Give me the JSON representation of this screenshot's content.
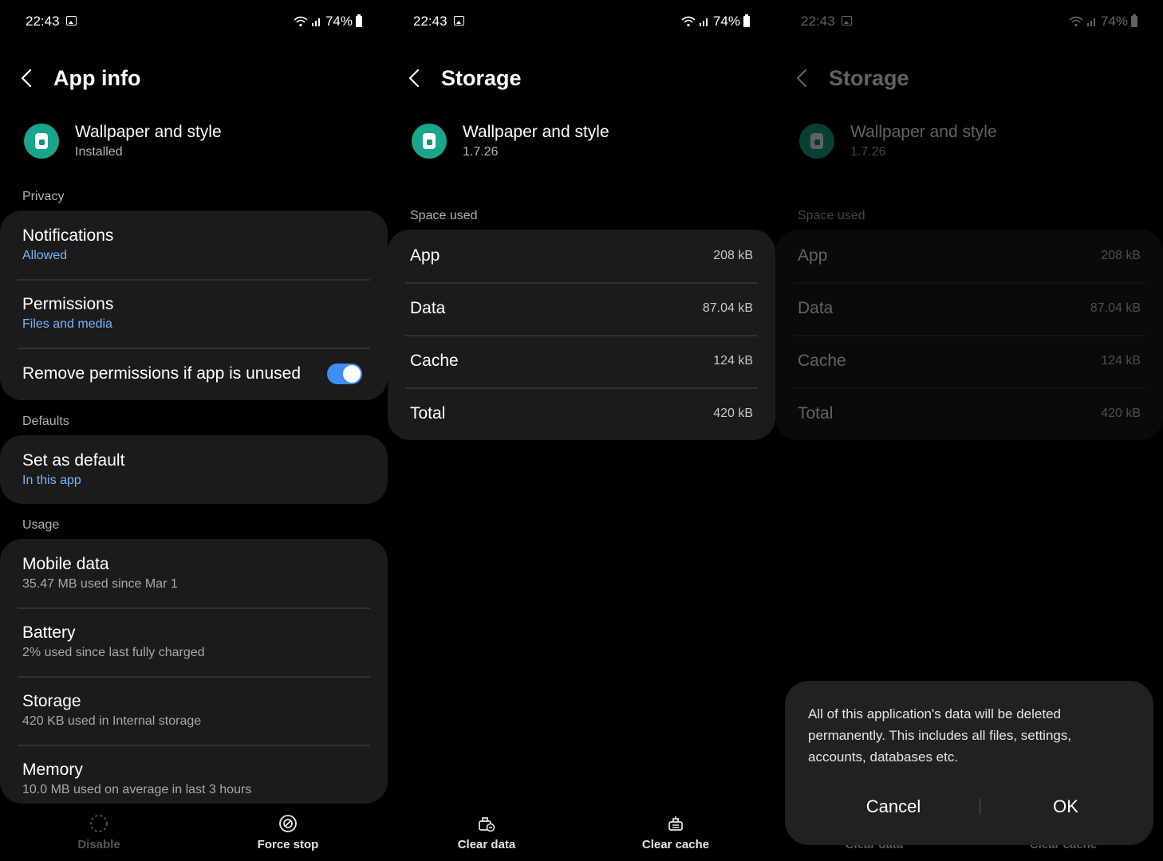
{
  "status": {
    "time": "22:43",
    "battery": "74%"
  },
  "screen1": {
    "title": "App info",
    "app": {
      "name": "Wallpaper and style",
      "status": "Installed"
    },
    "privacy": {
      "label": "Privacy",
      "notifications": {
        "title": "Notifications",
        "sub": "Allowed"
      },
      "permissions": {
        "title": "Permissions",
        "sub": "Files and media"
      },
      "remove_permissions": {
        "title": "Remove permissions if app is unused",
        "enabled": true
      }
    },
    "defaults": {
      "label": "Defaults",
      "set_default": {
        "title": "Set as default",
        "sub": "In this app"
      }
    },
    "usage": {
      "label": "Usage",
      "mobile_data": {
        "title": "Mobile data",
        "sub": "35.47 MB used since Mar 1"
      },
      "battery": {
        "title": "Battery",
        "sub": "2% used since last fully charged"
      },
      "storage": {
        "title": "Storage",
        "sub": "420 KB used in Internal storage"
      },
      "memory": {
        "title": "Memory",
        "sub": "10.0 MB used on average in last 3 hours"
      }
    },
    "bottom": {
      "disable": "Disable",
      "force_stop": "Force stop"
    }
  },
  "screen2": {
    "title": "Storage",
    "app": {
      "name": "Wallpaper and style",
      "version": "1.7.26"
    },
    "space_used_label": "Space used",
    "rows": [
      {
        "label": "App",
        "value": "208 kB"
      },
      {
        "label": "Data",
        "value": "87.04 kB"
      },
      {
        "label": "Cache",
        "value": "124 kB"
      },
      {
        "label": "Total",
        "value": "420 kB"
      }
    ],
    "bottom": {
      "clear_data": "Clear data",
      "clear_cache": "Clear cache"
    }
  },
  "dialog": {
    "message": "All of this application's data will be deleted permanently. This includes all files, settings, accounts, databases etc.",
    "cancel": "Cancel",
    "ok": "OK"
  },
  "colors": {
    "accent": "#3e8ff3",
    "link": "#79b5ff",
    "app_icon": "#1aa68b",
    "card": "#1b1b1b",
    "dialog": "#212121"
  }
}
